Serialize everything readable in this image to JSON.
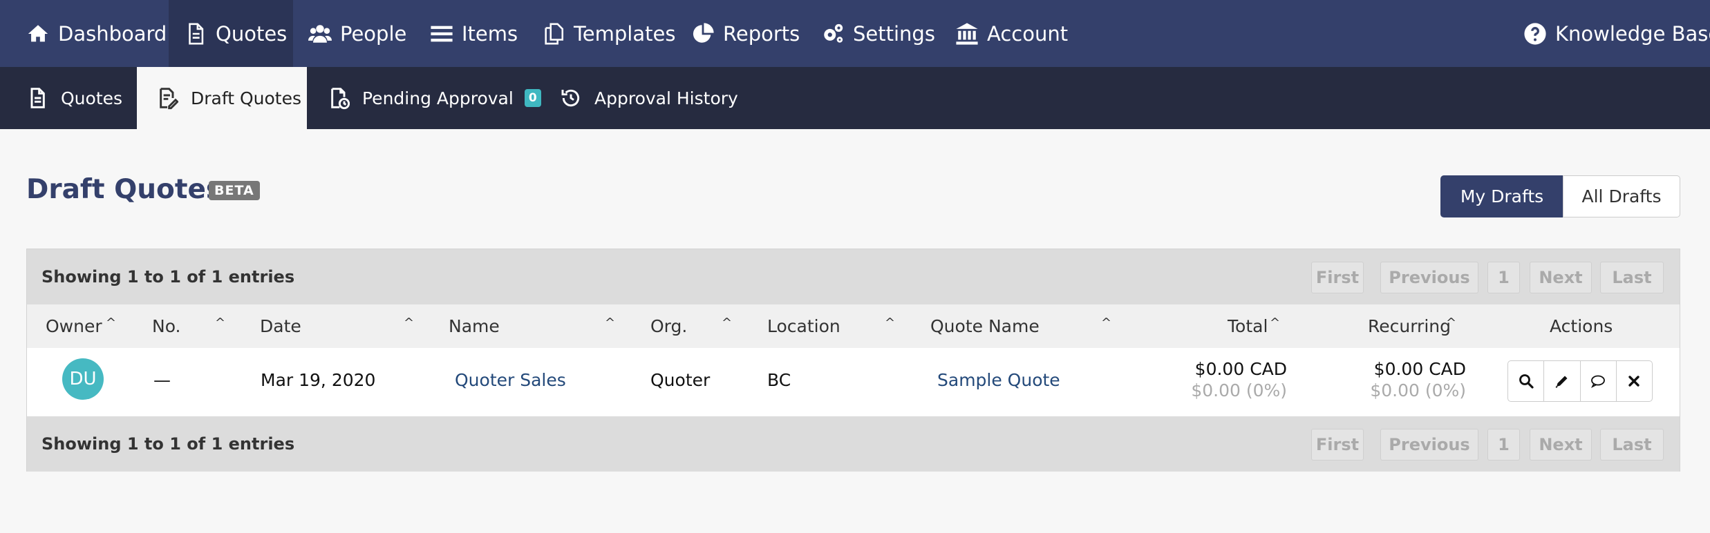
{
  "topnav": {
    "items": [
      {
        "label": "Dashboard",
        "icon": "home-icon"
      },
      {
        "label": "Quotes",
        "icon": "document-icon"
      },
      {
        "label": "People",
        "icon": "users-icon"
      },
      {
        "label": "Items",
        "icon": "list-icon"
      },
      {
        "label": "Templates",
        "icon": "copy-icon"
      },
      {
        "label": "Reports",
        "icon": "pie-chart-icon"
      },
      {
        "label": "Settings",
        "icon": "gears-icon"
      },
      {
        "label": "Account",
        "icon": "bank-icon"
      }
    ],
    "help_label": "Knowledge Base",
    "active": "Quotes"
  },
  "subnav": {
    "items": [
      {
        "label": "Quotes"
      },
      {
        "label": "Draft Quotes"
      },
      {
        "label": "Pending Approval",
        "count": "0"
      },
      {
        "label": "Approval History"
      }
    ],
    "active": "Draft Quotes"
  },
  "page": {
    "title": "Draft Quotes",
    "badge": "BETA",
    "toggle_mine": "My Drafts",
    "toggle_all": "All Drafts",
    "toggle_selected": "My Drafts"
  },
  "table": {
    "info": "Showing 1 to 1 of 1 entries",
    "pager": {
      "first": "First",
      "previous": "Previous",
      "page": "1",
      "next": "Next",
      "last": "Last"
    },
    "columns": [
      "Owner",
      "No.",
      "Date",
      "Name",
      "Org.",
      "Location",
      "Quote Name",
      "Total",
      "Recurring",
      "Actions"
    ],
    "sort_glyph": "^",
    "rows": [
      {
        "owner_initials": "DU",
        "number": "—",
        "date": "Mar 19, 2020",
        "name": "Quoter Sales",
        "org": "Quoter",
        "location": "BC",
        "quote_name": "Sample Quote",
        "total": "$0.00 CAD",
        "total_sub": "$0.00 (0%)",
        "recurring": "$0.00 CAD",
        "recurring_sub": "$0.00 (0%)"
      }
    ]
  },
  "colors": {
    "nav": "#34406b",
    "subnav": "#262b40",
    "accent": "#46b9c2",
    "link": "#23497a"
  }
}
